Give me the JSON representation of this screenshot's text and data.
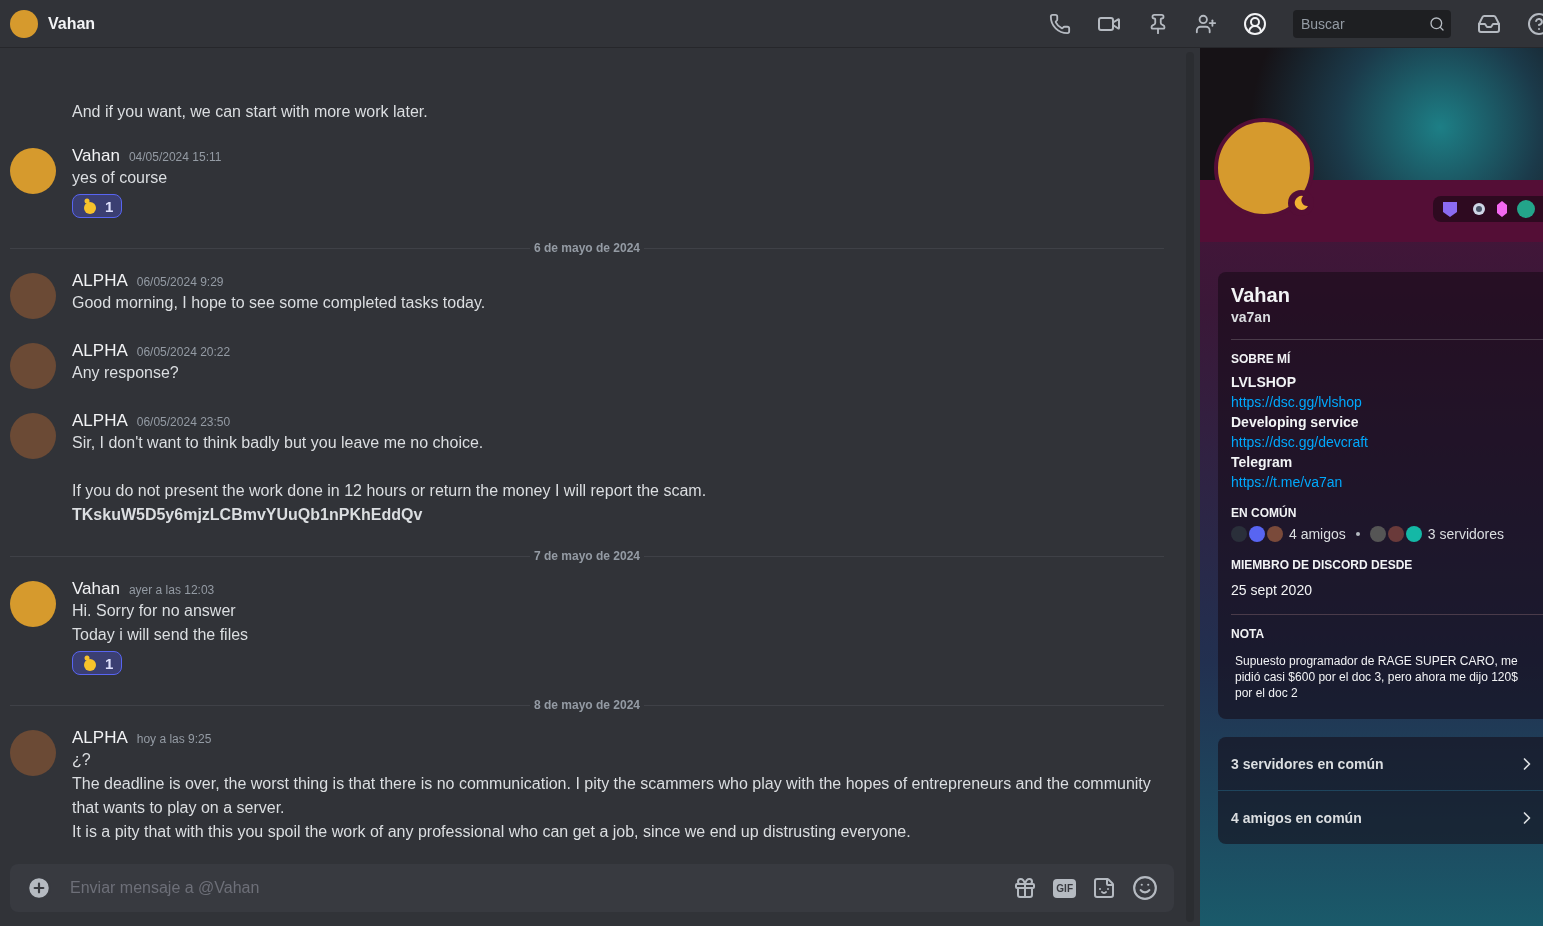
{
  "header": {
    "title": "Vahan",
    "search": {
      "placeholder": "Buscar"
    }
  },
  "chat": [
    {
      "kind": "continuation",
      "lines": [
        {
          "text": "And if you want, we can start with more work later.",
          "bold": false,
          "spaced": false
        }
      ]
    },
    {
      "kind": "message",
      "author": "Vahan",
      "color": "#d69a2d",
      "time": "04/05/2024 15:11",
      "lines": [
        {
          "text": "yes of course",
          "bold": false,
          "spaced": false
        }
      ],
      "reaction": {
        "count": "1"
      }
    },
    {
      "kind": "divider",
      "label": "6 de mayo de 2024"
    },
    {
      "kind": "message",
      "author": "ALPHA",
      "color": "#6b4a35",
      "time": "06/05/2024 9:29",
      "lines": [
        {
          "text": "Good morning, I hope to see some completed tasks today.",
          "bold": false,
          "spaced": false
        }
      ]
    },
    {
      "kind": "message",
      "author": "ALPHA",
      "color": "#6b4a35",
      "time": "06/05/2024 20:22",
      "lines": [
        {
          "text": "Any response?",
          "bold": false,
          "spaced": false
        }
      ]
    },
    {
      "kind": "message",
      "author": "ALPHA",
      "color": "#6b4a35",
      "time": "06/05/2024 23:50",
      "lines": [
        {
          "text": "Sir, I don't want to think badly but you leave me no choice.",
          "bold": false,
          "spaced": false
        },
        {
          "text": "If you do not present the work done in 12 hours or return the money I will report the scam.",
          "bold": false,
          "spaced": true
        },
        {
          "text": "TKskuW5D5y6mjzLCBmvYUuQb1nPKhEddQv",
          "bold": true,
          "spaced": false
        }
      ]
    },
    {
      "kind": "divider",
      "label": "7 de mayo de 2024"
    },
    {
      "kind": "message",
      "author": "Vahan",
      "color": "#d69a2d",
      "time": "ayer a las 12:03",
      "lines": [
        {
          "text": "Hi. Sorry for no answer",
          "bold": false,
          "spaced": false
        },
        {
          "text": "Today i will send the files",
          "bold": false,
          "spaced": false
        }
      ],
      "reaction": {
        "count": "1"
      }
    },
    {
      "kind": "divider",
      "label": "8 de mayo de 2024"
    },
    {
      "kind": "message",
      "author": "ALPHA",
      "color": "#6b4a35",
      "time": "hoy a las 9:25",
      "lines": [
        {
          "text": "¿?",
          "bold": false,
          "spaced": false
        },
        {
          "text": "The deadline is over, the worst thing is that there is no communication. I pity the scammers who play with the hopes of entrepreneurs and the community that wants to play on a server.",
          "bold": false,
          "spaced": false
        },
        {
          "text": "It is a pity that with this you spoil the work of any professional who can get a job, since we end up distrusting everyone.",
          "bold": false,
          "spaced": false
        }
      ]
    }
  ],
  "composer": {
    "placeholder": "Enviar mensaje a @Vahan",
    "gif": "GIF"
  },
  "profile": {
    "name": "Vahan",
    "username": "va7an",
    "about_title": "SOBRE MÍ",
    "about": [
      {
        "kind": "title",
        "text": "LVLSHOP"
      },
      {
        "kind": "link",
        "text": "https://dsc.gg/lvlshop"
      },
      {
        "kind": "title",
        "text": "Developing service"
      },
      {
        "kind": "link",
        "text": "https://dsc.gg/devcraft"
      },
      {
        "kind": "title",
        "text": "Telegram"
      },
      {
        "kind": "link",
        "text": "https://t.me/va7an"
      }
    ],
    "common_title": "EN COMÚN",
    "friends": "4 amigos",
    "servers": "3 servidores",
    "member_title": "MIEMBRO DE DISCORD DESDE",
    "member_since": "25 sept 2020",
    "note_title": "NOTA",
    "note": "Supuesto programador de RAGE SUPER CARO, me pidió casi $600 por el doc 3, pero ahora me dijo 120$ por el doc 2",
    "rows": [
      "3 servidores en común",
      "4 amigos en común"
    ]
  }
}
